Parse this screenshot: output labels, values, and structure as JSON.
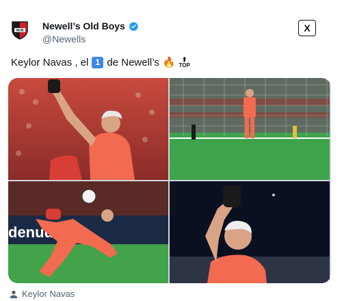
{
  "account": {
    "display_name": "Newell’s Old Boys",
    "handle": "@Newells",
    "avatar_icon": "nob-crest-icon",
    "verified_icon": "verified-badge-icon",
    "verified_color": "#1d9bf0"
  },
  "tweet": {
    "text_before": "Keylor Navas , el",
    "number_badge": "1",
    "text_after": "de Newell’s",
    "fire_emoji": "🔥",
    "top_label": "TOP",
    "top_arrow": "⬆"
  },
  "media": {
    "icons": [
      "goalkeeper-celebration-photo",
      "goalkeeper-on-goal-line-photo",
      "goalkeeper-diving-save-photo",
      "goalkeeper-night-portrait-photo"
    ],
    "jersey_color": "#f26a4f",
    "ad_board_text": "denuumate"
  },
  "caption": {
    "icon": "person-icon",
    "text": "Keylor Navas"
  },
  "top_right": {
    "icon": "x-logo-icon",
    "label": "X"
  }
}
